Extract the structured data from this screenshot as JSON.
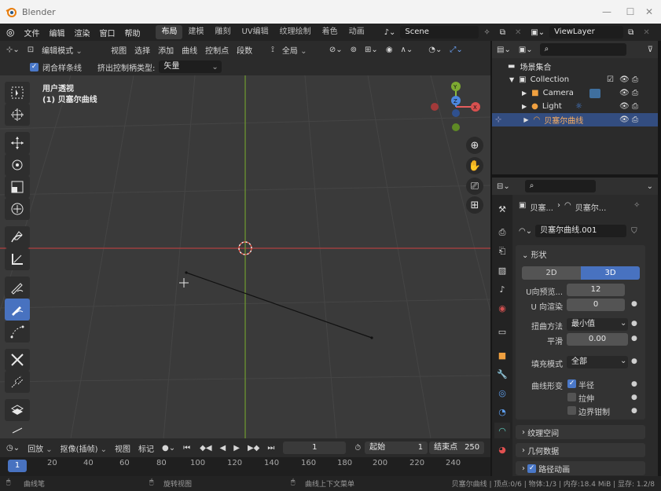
{
  "window": {
    "title": "Blender"
  },
  "menu": {
    "items": [
      "文件",
      "编辑",
      "渲染",
      "窗口",
      "帮助"
    ],
    "workspaces": [
      "布局",
      "建模",
      "雕刻",
      "UV编辑",
      "纹理绘制",
      "着色",
      "动画"
    ],
    "scene": "Scene",
    "view_layer": "ViewLayer"
  },
  "viewport_header": {
    "mode": "编辑模式",
    "menus": [
      "视图",
      "选择",
      "添加",
      "曲线",
      "控制点",
      "段数"
    ],
    "transform_orientation": "全局"
  },
  "viewport_options": {
    "closed_checkbox_label": "闭合样条线",
    "handle_type_label": "挤出控制柄类型:",
    "handle_type_value": "矢量"
  },
  "viewport": {
    "view_name": "用户透视",
    "object_name": "(1) 贝塞尔曲线"
  },
  "timeline": {
    "playback": "回放",
    "keying": "抠像(插帧)",
    "view": "视图",
    "marker": "标记",
    "current_frame": "1",
    "start_label": "起始",
    "start_value": "1",
    "end_label": "结束点",
    "end_value": "250",
    "ruler_current": "1",
    "ruler_ticks": [
      "20",
      "40",
      "60",
      "80",
      "100",
      "120",
      "140",
      "160",
      "180",
      "200",
      "220",
      "240"
    ]
  },
  "statusbar": {
    "left": "曲线笔",
    "middle": "旋转视图",
    "right_action": "曲线上下文菜单",
    "info": "贝塞尔曲线 | 顶点:0/6 | 物体:1/3 | 内存:18.4 MiB | 显存: 1.2/8"
  },
  "outliner": {
    "scene_collection": "场景集合",
    "items": [
      {
        "label": "Collection"
      },
      {
        "label": "Camera"
      },
      {
        "label": "Light"
      },
      {
        "label": "贝塞尔曲线"
      }
    ]
  },
  "properties": {
    "breadcrumb_a": "贝塞...",
    "breadcrumb_b": "贝塞尔...",
    "datablock": "贝塞尔曲线.001",
    "shape_panel": "形状",
    "dim_2d": "2D",
    "dim_3d": "3D",
    "u_preview_label": "U向预览...",
    "u_preview_value": "12",
    "u_render_label": "U 向渲染",
    "u_render_value": "0",
    "twist_label": "扭曲方法",
    "twist_value": "最小值",
    "smooth_label": "平滑",
    "smooth_value": "0.00",
    "fill_label": "填充模式",
    "fill_value": "全部",
    "deform_label": "曲线形变",
    "radius_label": "半径",
    "stretch_label": "拉伸",
    "clamp_label": "边界钳制",
    "texture_space_panel": "纹理空间",
    "geometry_panel": "几何数据",
    "path_anim_panel": "路径动画"
  }
}
